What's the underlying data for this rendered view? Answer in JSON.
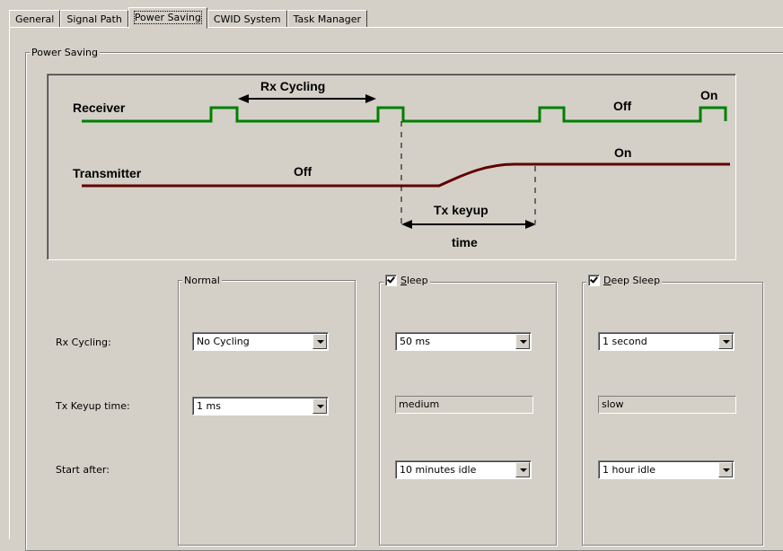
{
  "tabs": [
    {
      "label": "General"
    },
    {
      "label": "Signal Path"
    },
    {
      "label": "Power Saving",
      "active": true
    },
    {
      "label": "CWID System"
    },
    {
      "label": "Task Manager"
    }
  ],
  "power_saving": {
    "group_title": "Power Saving",
    "diagram": {
      "receiver_label": "Receiver",
      "transmitter_label": "Transmitter",
      "rx_cycling_label": "Rx Cycling",
      "receiver_off": "Off",
      "receiver_on": "On",
      "transmitter_off": "Off",
      "transmitter_on": "On",
      "tx_keyup_label": "Tx keyup",
      "time_label": "time",
      "receiver_color": "#008000",
      "transmitter_color": "#600000"
    }
  },
  "rows": {
    "rx_cycling": "Rx Cycling:",
    "tx_keyup": "Tx Keyup time:",
    "start_after": "Start after:"
  },
  "modes": {
    "normal": {
      "title": "Normal",
      "rx_cycling": "No Cycling",
      "tx_keyup": "1 ms"
    },
    "sleep": {
      "title": "Sleep",
      "accel": "S",
      "title_rest": "leep",
      "checked": true,
      "rx_cycling": "50 ms",
      "tx_keyup": "medium",
      "start_after": "10 minutes idle"
    },
    "deep_sleep": {
      "title": "Deep Sleep",
      "accel": "D",
      "title_rest": "eep Sleep",
      "checked": true,
      "rx_cycling": "1 second",
      "tx_keyup": "slow",
      "start_after": "1 hour idle"
    }
  }
}
